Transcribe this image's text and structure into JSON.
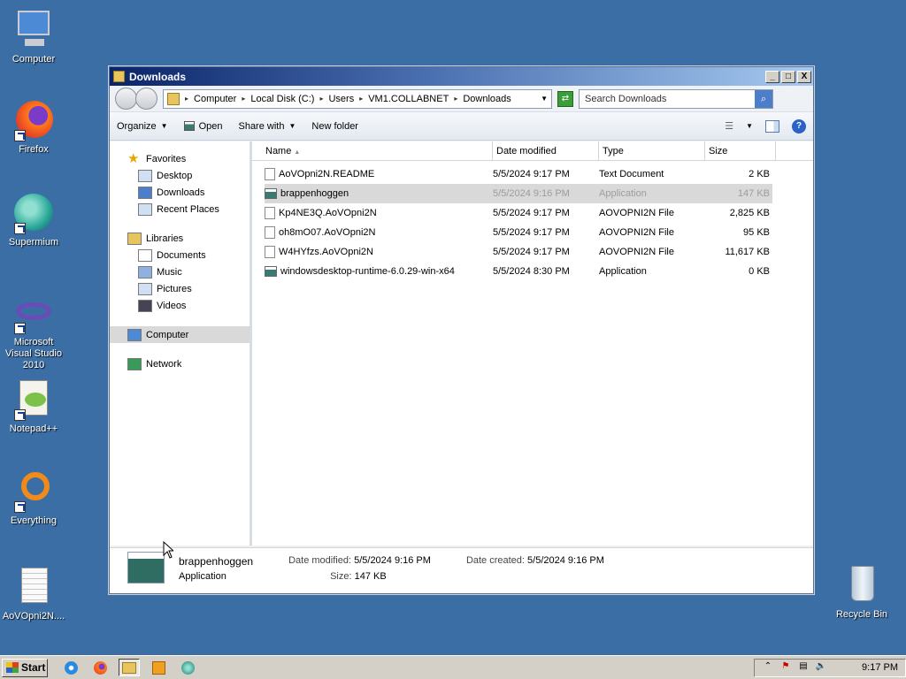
{
  "desktop": {
    "icons": [
      {
        "label": "Computer"
      },
      {
        "label": "Firefox"
      },
      {
        "label": "Supermium"
      },
      {
        "label": "Microsoft Visual Studio 2010"
      },
      {
        "label": "Notepad++"
      },
      {
        "label": "Everything"
      },
      {
        "label": "AoVOpni2N...."
      },
      {
        "label": "Recycle Bin"
      }
    ]
  },
  "window": {
    "title": "Downloads",
    "controls": {
      "minimize": "_",
      "maximize": "□",
      "close": "X"
    },
    "address": {
      "crumbs": [
        "Computer",
        "Local Disk (C:)",
        "Users",
        "VM1.COLLABNET",
        "Downloads"
      ]
    },
    "search": {
      "placeholder": "Search Downloads"
    },
    "toolbar": {
      "organize": "Organize",
      "open": "Open",
      "share_with": "Share with",
      "new_folder": "New folder"
    },
    "nav": {
      "favorites": "Favorites",
      "desktop": "Desktop",
      "downloads": "Downloads",
      "recent_places": "Recent Places",
      "libraries": "Libraries",
      "documents": "Documents",
      "music": "Music",
      "pictures": "Pictures",
      "videos": "Videos",
      "computer": "Computer",
      "network": "Network"
    },
    "columns": {
      "name": "Name",
      "date": "Date modified",
      "type": "Type",
      "size": "Size"
    },
    "files": [
      {
        "name": "AoVOpni2N.README",
        "date": "5/5/2024 9:17 PM",
        "type": "Text Document",
        "size": "2 KB"
      },
      {
        "name": "brappenhoggen",
        "date": "5/5/2024 9:16 PM",
        "type": "Application",
        "size": "147 KB"
      },
      {
        "name": "Kp4NE3Q.AoVOpni2N",
        "date": "5/5/2024 9:17 PM",
        "type": "AOVOPNI2N File",
        "size": "2,825 KB"
      },
      {
        "name": "oh8mO07.AoVOpni2N",
        "date": "5/5/2024 9:17 PM",
        "type": "AOVOPNI2N File",
        "size": "95 KB"
      },
      {
        "name": "W4HYfzs.AoVOpni2N",
        "date": "5/5/2024 9:17 PM",
        "type": "AOVOPNI2N File",
        "size": "11,617 KB"
      },
      {
        "name": "windowsdesktop-runtime-6.0.29-win-x64",
        "date": "5/5/2024 8:30 PM",
        "type": "Application",
        "size": "0 KB"
      }
    ],
    "details": {
      "name": "brappenhoggen",
      "type": "Application",
      "date_modified_label": "Date modified:",
      "date_modified": "5/5/2024 9:16 PM",
      "size_label": "Size:",
      "size": "147 KB",
      "date_created_label": "Date created:",
      "date_created": "5/5/2024 9:16 PM"
    }
  },
  "taskbar": {
    "start": "Start",
    "clock": "9:17 PM"
  }
}
